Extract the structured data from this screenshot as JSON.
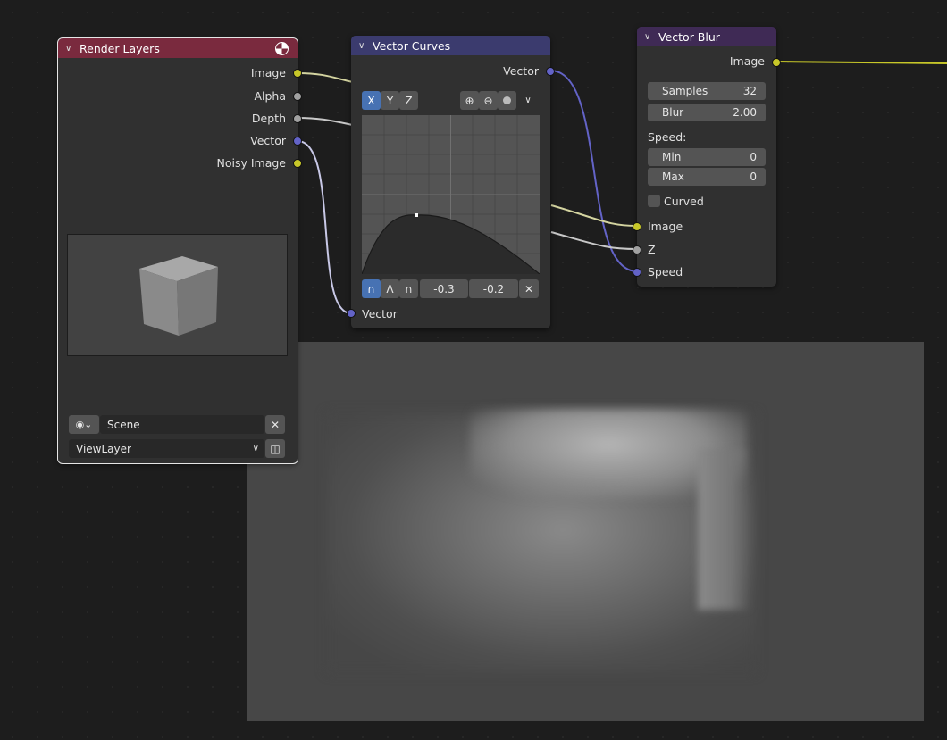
{
  "nodes": {
    "render_layers": {
      "title": "Render Layers",
      "header_color": "#7a2a3e",
      "outputs": [
        "Image",
        "Alpha",
        "Depth",
        "Vector",
        "Noisy Image"
      ],
      "scene_label": "Scene",
      "view_layer": "ViewLayer"
    },
    "vector_curves": {
      "title": "Vector Curves",
      "header_color": "#3b3b6e",
      "output": "Vector",
      "input": "Vector",
      "axis_tabs": [
        "X",
        "Y",
        "Z"
      ],
      "active_axis": "X",
      "point_x": "-0.3",
      "point_y": "-0.2"
    },
    "vector_blur": {
      "title": "Vector Blur",
      "header_color": "#3f2a55",
      "output": "Image",
      "samples_label": "Samples",
      "samples_value": "32",
      "blur_label": "Blur",
      "blur_value": "2.00",
      "speed_label": "Speed:",
      "min_label": "Min",
      "min_value": "0",
      "max_label": "Max",
      "max_value": "0",
      "curved_label": "Curved",
      "curved_checked": false,
      "inputs": [
        "Image",
        "Z",
        "Speed"
      ]
    }
  },
  "socket_colors": {
    "color": "#c7c729",
    "value": "#a1a1a1",
    "vector": "#6363c7"
  }
}
